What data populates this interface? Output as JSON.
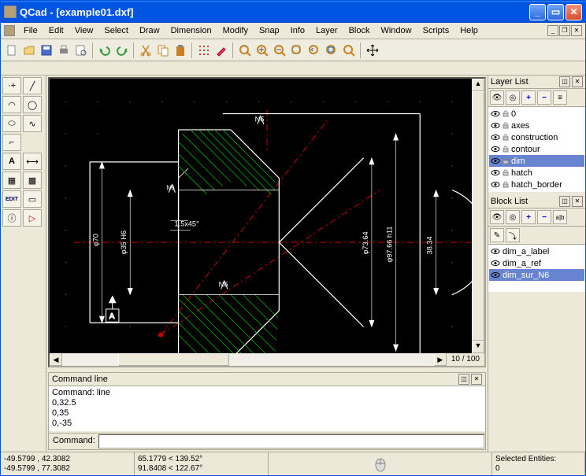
{
  "window": {
    "title": "QCad - [example01.dxf]"
  },
  "menu": [
    "File",
    "Edit",
    "View",
    "Select",
    "Draw",
    "Dimension",
    "Modify",
    "Snap",
    "Info",
    "Layer",
    "Block",
    "Window",
    "Scripts",
    "Help"
  ],
  "command_panel": {
    "title": "Command line",
    "history": [
      "Command: line",
      "0,32.5",
      "0,35",
      "0,-35"
    ],
    "prompt": "Command:",
    "value": ""
  },
  "layers": {
    "title": "Layer List",
    "items": [
      "0",
      "axes",
      "construction",
      "contour",
      "dim",
      "hatch",
      "hatch_border"
    ],
    "selected": "dim"
  },
  "blocks": {
    "title": "Block List",
    "items": [
      "dim_a_label",
      "dim_a_ref",
      "dim_sur_N6"
    ],
    "selected": "dim_sur_N6"
  },
  "canvas": {
    "zoom": "10 / 100",
    "annotations": {
      "n6_top": "N6",
      "n6_bot": "N6",
      "dim15": "1.5x45°",
      "phi70": "φ70",
      "phi35h6": "φ35 H6",
      "phi7364": "φ73.64",
      "phi9766": "φ97.66 h11",
      "r3834": "38.34",
      "a_label": "A"
    }
  },
  "status": {
    "coord1": "-49.5799 , 42.3082",
    "coord2": "-49.5799 , 77.3082",
    "polar1": "65.1779 < 139.52°",
    "polar2": "91.8408 < 122.67°",
    "selected_label": "Selected Entities:",
    "selected_count": "0"
  }
}
